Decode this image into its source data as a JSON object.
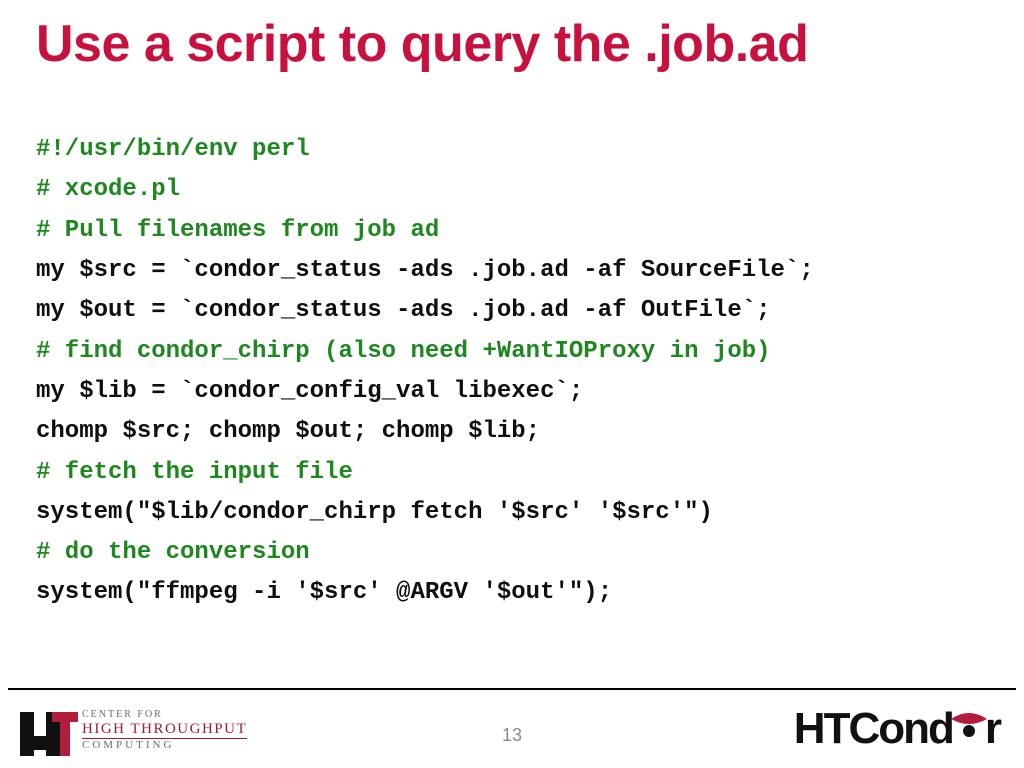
{
  "title": "Use a script to query the .job.ad",
  "code": {
    "l1": "#!/usr/bin/env perl",
    "l2": "# xcode.pl",
    "l3": "# Pull filenames from job ad",
    "l4": "my $src = `condor_status -ads .job.ad -af SourceFile`;",
    "l5": "my $out = `condor_status -ads .job.ad -af OutFile`;",
    "l6": "# find condor_chirp (also need +WantIOProxy in job)",
    "l7": "my $lib = `condor_config_val libexec`;",
    "l8": "chomp $src; chomp $out; chomp $lib;",
    "l9": "# fetch the input file",
    "l10": "system(\"$lib/condor_chirp fetch '$src' '$src'\")",
    "l11": "# do the conversion",
    "l12": "system(\"ffmpeg -i '$src' @ARGV '$out'\");"
  },
  "page_number": "13",
  "chtc": {
    "l1": "CENTER FOR",
    "l2": "HIGH THROUGHPUT",
    "l3": "COMPUTING"
  },
  "htcondor": {
    "ht": "HT",
    "c": "C",
    "rest": "ond",
    "r": "r"
  }
}
